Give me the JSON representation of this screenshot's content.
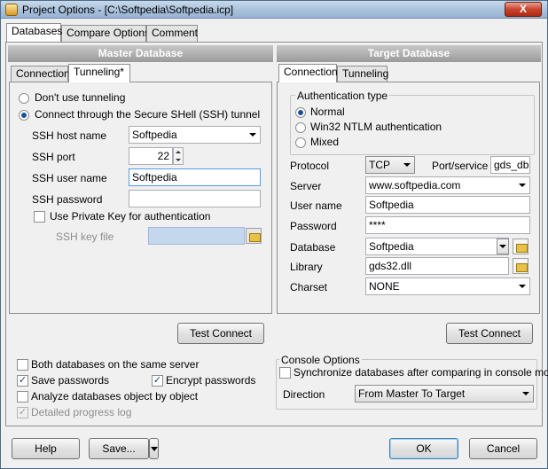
{
  "window": {
    "title": "Project Options - [C:\\Softpedia\\Softpedia.icp]",
    "close_label": "X"
  },
  "tabs": [
    "Databases",
    "Compare Options",
    "Comment"
  ],
  "master": {
    "header": "Master Database",
    "tabs": [
      "Connection",
      "Tunneling*"
    ],
    "tunnel": {
      "no_tunnel": "Don't use tunneling",
      "ssh_tunnel": "Connect through the Secure SHell (SSH) tunnel",
      "host_label": "SSH host name",
      "host_value": "Softpedia",
      "port_label": "SSH port",
      "port_value": "22",
      "user_label": "SSH user name",
      "user_value": "Softpedia",
      "password_label": "SSH password",
      "password_value": "",
      "private_key_label": "Use Private Key for authentication",
      "key_file_label": "SSH key file",
      "key_file_value": ""
    },
    "test_connect": "Test Connect"
  },
  "target": {
    "header": "Target Database",
    "tabs": [
      "Connection",
      "Tunneling"
    ],
    "auth_title": "Authentication type",
    "auth": [
      "Normal",
      "Win32 NTLM authentication",
      "Mixed"
    ],
    "protocol_label": "Protocol",
    "protocol_value": "TCP",
    "port_label": "Port/service",
    "port_value": "gds_db",
    "server_label": "Server",
    "server_value": "www.softpedia.com",
    "user_label": "User name",
    "user_value": "Softpedia",
    "password_label": "Password",
    "password_value": "****",
    "database_label": "Database",
    "database_value": "Softpedia",
    "library_label": "Library",
    "library_value": "gds32.dll",
    "charset_label": "Charset",
    "charset_value": "NONE",
    "test_connect": "Test Connect"
  },
  "options": {
    "same_server": "Both databases on the same server",
    "save_passwords": "Save passwords",
    "encrypt_passwords": "Encrypt passwords",
    "analyze": "Analyze databases object by object",
    "detailed_log": "Detailed progress log"
  },
  "console": {
    "title": "Console Options",
    "sync": "Synchronize databases after comparing in console mode",
    "direction_label": "Direction",
    "direction_value": "From Master To Target"
  },
  "footer": {
    "help": "Help",
    "save": "Save...",
    "ok": "OK",
    "cancel": "Cancel"
  },
  "colors": {
    "focus": "#569de5",
    "header": "#9a9a9a",
    "title_bar": "#a9c1dc"
  },
  "icons": {
    "check": "✓"
  }
}
